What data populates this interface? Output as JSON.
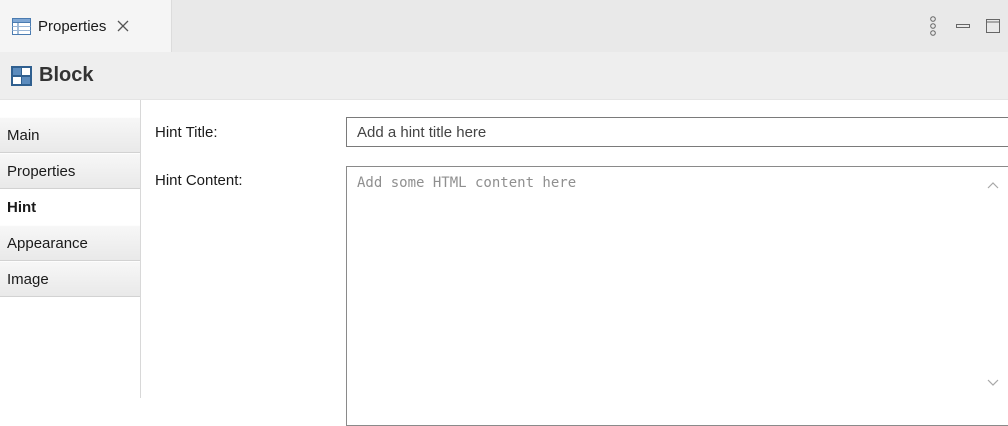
{
  "tab": {
    "label": "Properties",
    "icon": "properties-table-icon"
  },
  "header_icons": [
    "view-menu-icon",
    "minimize-icon",
    "maximize-icon"
  ],
  "title": {
    "text": "Block",
    "icon": "block-icon"
  },
  "sidebar": {
    "items": [
      {
        "label": "Main"
      },
      {
        "label": "Properties"
      },
      {
        "label": "Hint",
        "active": true
      },
      {
        "label": "Appearance"
      },
      {
        "label": "Image"
      }
    ]
  },
  "form": {
    "hint_title_label": "Hint Title:",
    "hint_title_placeholder": "Add a hint title here",
    "hint_content_label": "Hint Content:",
    "hint_content_placeholder": "Add some HTML content here"
  },
  "colors": {
    "tab_bar": "#e9e9e9",
    "title_bar": "#eeeeee",
    "icon_blue": "#2f5f8f"
  }
}
